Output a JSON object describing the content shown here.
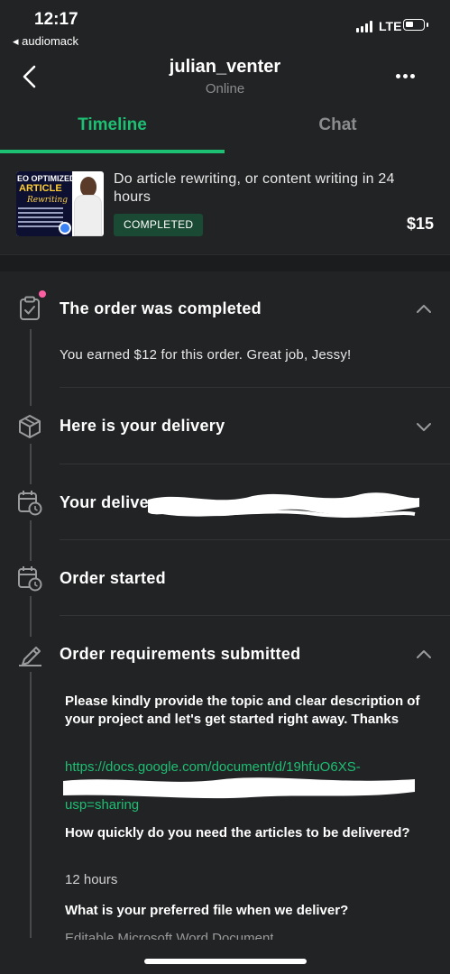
{
  "status_bar": {
    "time": "12:17",
    "back_app": "◂ audiomack",
    "network": "LTE"
  },
  "header": {
    "username": "julian_venter",
    "status": "Online"
  },
  "tabs": [
    {
      "label": "Timeline",
      "active": true
    },
    {
      "label": "Chat",
      "active": false
    }
  ],
  "order": {
    "gig_title": "Do article rewriting, or content writing in 24 hours",
    "status": "COMPLETED",
    "price": "$15",
    "thumbnail": {
      "line1": "EO OPTIMIZED",
      "line2": "ARTICLE",
      "line3": "Rewriting"
    }
  },
  "timeline": [
    {
      "title": "The order was completed",
      "icon": "clipboard-check-icon",
      "expanded": true,
      "body": "You earned $12 for this order. Great job, Jessy!"
    },
    {
      "title": "Here is your delivery",
      "icon": "box-icon",
      "expanded": false
    },
    {
      "title": "Your delive",
      "icon": "calendar-clock-icon",
      "expanded": false
    },
    {
      "title": "Order started",
      "icon": "calendar-clock-icon",
      "expanded": false
    },
    {
      "title": "Order requirements submitted",
      "icon": "pencil-icon",
      "expanded": true
    }
  ],
  "requirements": {
    "q1": "Please kindly provide the topic and clear description of your project and let's get started right away. Thanks",
    "link_line1": "https://docs.google.com/document/d/19hfuO6XS-",
    "link_line3": "usp=sharing",
    "q2": "How quickly do you need the articles to be delivered?",
    "a2": "12 hours",
    "q3": "What is your preferred file when we deliver?",
    "a3_partial": "Editable Microsoft Word Document"
  },
  "colors": {
    "background": "#222325",
    "accent_green": "#1dbf73",
    "completed_badge": "#1a4a34",
    "notification_dot": "#ff5fa2"
  }
}
